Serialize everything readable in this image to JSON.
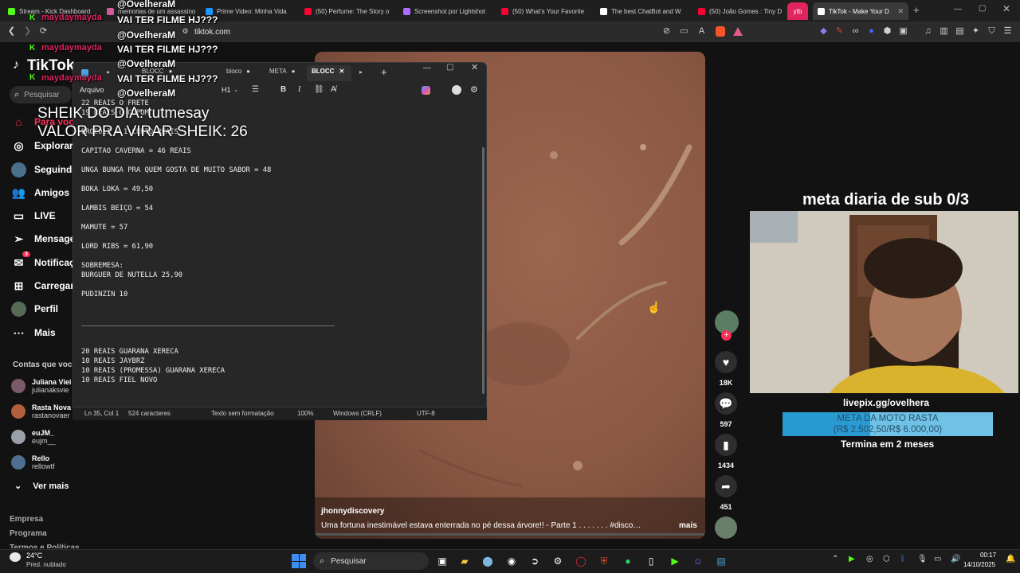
{
  "browser": {
    "tabs": [
      {
        "label": "Stream - Kick Dashboard",
        "color": "#53fc18"
      },
      {
        "label": "memorias de um assassino",
        "color": "#d25a9a"
      },
      {
        "label": "Prime Video: Minha Vida",
        "color": "#1a98ff"
      },
      {
        "label": "(50) Perfume: The Story o",
        "color": "#ff0033"
      },
      {
        "label": "Screenshot por Lightshot",
        "color": "#b06cff"
      },
      {
        "label": "(50) What's Your Favorite",
        "color": "#ff0033"
      },
      {
        "label": "The best ChatBot and W",
        "color": "#ffffff"
      },
      {
        "label": "(50) João Gomes : Tiny D",
        "color": "#ff0033"
      },
      {
        "label": "ytb",
        "color": "#e0245e"
      },
      {
        "label": "TikTok - Make Your D",
        "color": "#ffffff"
      }
    ],
    "new_tab": "+",
    "url": "tiktok.com"
  },
  "tiktok": {
    "logo": "TikTok",
    "search_placeholder": "Pesquisar",
    "nav": [
      {
        "label": "Para você",
        "icon": "home-icon"
      },
      {
        "label": "Explorar",
        "icon": "compass-icon"
      },
      {
        "label": "Seguindo",
        "icon": "following-icon"
      },
      {
        "label": "Amigos",
        "icon": "friends-icon"
      },
      {
        "label": "LIVE",
        "icon": "live-icon"
      },
      {
        "label": "Mensagens",
        "icon": "message-icon"
      },
      {
        "label": "Notificações",
        "icon": "bell-icon",
        "badge": "3"
      },
      {
        "label": "Carregar",
        "icon": "upload-icon"
      },
      {
        "label": "Perfil",
        "icon": "profile-icon"
      },
      {
        "label": "Mais",
        "icon": "more-icon"
      }
    ],
    "following_header": "Contas que você",
    "accounts": [
      {
        "name": "Juliana Viei",
        "handle": "julianaksvie"
      },
      {
        "name": "Rasta Nova",
        "handle": "rastanovaer"
      },
      {
        "name": "euJM_",
        "handle": "eujm__"
      },
      {
        "name": "Rello",
        "handle": "rellowtf"
      }
    ],
    "see_more": "Ver mais",
    "footer": [
      "Empresa",
      "Programa",
      "Termos e Políticas"
    ],
    "video": {
      "author": "jhonnydiscovery",
      "caption": "Uma fortuna inestimável estava enterrada no pé dessa árvore!! - Parte 1 . . . . . . . #discovery ...",
      "more": "mais"
    },
    "actions": {
      "likes": "18K",
      "comments": "597",
      "saves": "1434",
      "shares": "451"
    }
  },
  "chat": {
    "lines": [
      {
        "user": "maydaymayda",
        "msg": "VAI TER FILME HJ???"
      },
      {
        "user": "@OvelheraM",
        "msg": "VAI TER FILME HJ???"
      },
      {
        "user": "maydaymayda",
        "msg": "VAI TER FILME HJ???"
      },
      {
        "user": "",
        "msg": "@OvelheraM"
      }
    ],
    "top_user": "@OvelheraM",
    "sheik": "SHEIK DO DIA: tutmesay",
    "valor": "VALOR PRA VIRAR SHEIK: 26"
  },
  "notepad": {
    "tabs": [
      "BLOCC",
      "bloco",
      "META",
      "BLOCC"
    ],
    "menu": [
      "Arquivo",
      "Editar",
      "Exibir"
    ],
    "heading": "H1",
    "content": "22 REAIS O FRETE\n19 REAIS O CUPOM\n\nBROCOLI + 1 CERTO REAIS\n\nCAPITAO CAVERNA = 46 REAIS\n\nUNGA BUNGA PRA QUEM GOSTA DE MUITO SABOR = 48\n\nBOKA LOKA = 49,50\n\nLAMBIS BEIÇO = 54\n\nMAMUTE = 57\n\nLORD RIBS = 61,90\n\nSOBREMESA:\nBURGUER DE NUTELLA 25,90\n\nPUDINZIN 10\n\n\n____________________________________________________________\n\n\n20 REAIS GUARANA XERECA\n10 REAIS JAYBRZ\n10 REAIS (PROMESSA) GUARANA XERECA\n10 REAIS FIEL NOVO",
    "status": {
      "position": "Ln 35, Col 1",
      "chars": "524 caracteres",
      "format": "Texto sem formatação",
      "zoom": "100%",
      "eol": "Windows (CRLF)",
      "encoding": "UTF-8"
    }
  },
  "stream_overlay": {
    "meta_sub": "meta diaria de sub 0/3",
    "livepix": "livepix.gg/ovelhera",
    "goal_title": "META DA MOTO RASTA",
    "goal_amount": "(R$ 2.502,50/R$ 6.000,00)",
    "goal_progress": 0.417,
    "goal_ends": "Termina em 2 meses"
  },
  "taskbar": {
    "weather_temp": "24°C",
    "weather_desc": "Pred. nublado",
    "search": "Pesquisar",
    "time": "00:17",
    "date": "14/10/2025"
  }
}
